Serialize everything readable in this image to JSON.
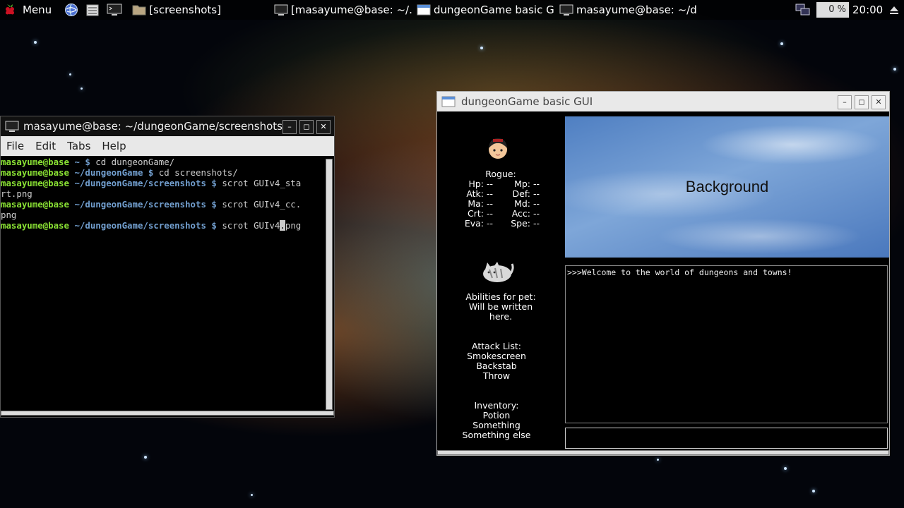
{
  "taskbar": {
    "menu_label": "Menu",
    "file_manager_label": "[screenshots]",
    "tasks": [
      "[masayume@base: ~/...",
      "dungeonGame basic G...",
      "masayume@base: ~/d..."
    ],
    "cpu_label": "0 %",
    "clock": "20:00"
  },
  "terminal": {
    "title": "masayume@base: ~/dungeonGame/screenshots",
    "menu": [
      "File",
      "Edit",
      "Tabs",
      "Help"
    ],
    "lines": [
      {
        "user": "masayume@base",
        "path": " ~ $",
        "cmd": " cd dungeonGame/"
      },
      {
        "user": "masayume@base",
        "path": " ~/dungeonGame $",
        "cmd": " cd screenshots/"
      },
      {
        "user": "masayume@base",
        "path": " ~/dungeonGame/screenshots $",
        "cmd": " scrot GUIv4_sta"
      },
      {
        "user": "",
        "path": "",
        "cmd": "rt.png"
      },
      {
        "user": "masayume@base",
        "path": " ~/dungeonGame/screenshots $",
        "cmd": " scrot GUIv4_cc."
      },
      {
        "user": "",
        "path": "",
        "cmd": "png"
      },
      {
        "user": "masayume@base",
        "path": " ~/dungeonGame/screenshots $",
        "cmd": " scrot GUIv4",
        "cursor": ".",
        "after": "png"
      }
    ]
  },
  "game": {
    "title": "dungeonGame basic GUI",
    "character_class": "Rogue:",
    "stats": [
      [
        "Hp:",
        "--",
        "Mp:",
        "--"
      ],
      [
        "Atk:",
        "--",
        "Def:",
        "--"
      ],
      [
        "Ma:",
        "--",
        "Md:",
        "--"
      ],
      [
        "Crt:",
        "--",
        "Acc:",
        "--"
      ],
      [
        "Eva:",
        "--",
        "Spe:",
        "--"
      ]
    ],
    "pet_abilities": [
      "Abilities for pet:",
      "Will be written",
      "here."
    ],
    "attack_list": [
      "Attack List:",
      "Smokescreen",
      "Backstab",
      "Throw"
    ],
    "inventory": [
      "Inventory:",
      "Potion",
      "Something",
      "Something else"
    ],
    "background_label": "Background",
    "log": ">>>Welcome to the world of dungeons and towns!",
    "input_value": ""
  }
}
